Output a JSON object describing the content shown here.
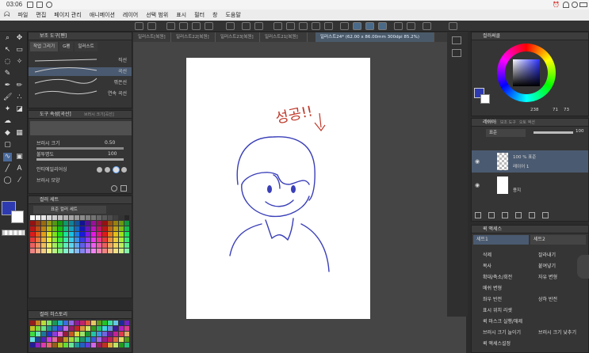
{
  "status": {
    "time": "03:06"
  },
  "menu": [
    "파일",
    "편집",
    "페이지 관리",
    "애니메이션",
    "레이어",
    "선택 범위",
    "표시",
    "필터",
    "창",
    "도움말"
  ],
  "tabs": [
    "일러스트[복원]",
    "일러스트22[복원]",
    "일러스트23[복원]",
    "일러스트21[복원]",
    "일러스트24* (62.00 x 86.00mm 300dpi 85.2%)"
  ],
  "sub_tool": {
    "title": "보조 도구[펜]",
    "tabs": [
      "작업 그리기",
      "G펜",
      "일러스트"
    ],
    "items": [
      "직선",
      "곡선",
      "꺾은선",
      "연속 곡선"
    ]
  },
  "tool_property": {
    "title": "도구 속성[곡선]",
    "subtitle": "브러시 크기[곡선]",
    "brush_size_label": "브러시 크기",
    "brush_size_value": "0.50",
    "opacity_label": "불투명도",
    "opacity_value": "100",
    "antialias_label": "안티에일리어싱",
    "brush_shape_label": "브러시 모양"
  },
  "color_set": {
    "title": "컬러 세트",
    "set_name": "표준 컬러 세트"
  },
  "color_history": {
    "title": "컬러 히스토리"
  },
  "color_wheel": {
    "title": "컬러써클",
    "h": "238",
    "s": "71",
    "v": "73"
  },
  "layers": {
    "title": "레이어",
    "tabs": [
      "레이어",
      "보조 도구",
      "오토 액션"
    ],
    "blend_mode": "표준",
    "opacity": "100",
    "items": [
      {
        "opacity": "100 % 표준",
        "name": "레이어 1"
      },
      {
        "name": "용지"
      }
    ]
  },
  "quick_access": {
    "title": "퀵 액세스",
    "sets": [
      "세트1",
      "세트2"
    ],
    "left": [
      "삭제",
      "복사",
      "확대/축소/회전",
      "메쉬 변형",
      "좌우 반전",
      "표시 위치 리셋",
      "퀵 마스크 실행/해제",
      "브러시 크기 늘이기",
      "퀵 액세스설정"
    ],
    "right": [
      "잘라내기",
      "붙여넣기",
      "자유 변형",
      "",
      "상하 반전",
      "",
      "",
      "브러시 크기 낮추기",
      ""
    ]
  },
  "canvas": {
    "annotation": "성공!!"
  },
  "colors": {
    "main": "#2e3bb0",
    "accent": "#3f6fd0",
    "drawing_line": "#3a3fb8",
    "annotation_red": "#c0392b"
  }
}
